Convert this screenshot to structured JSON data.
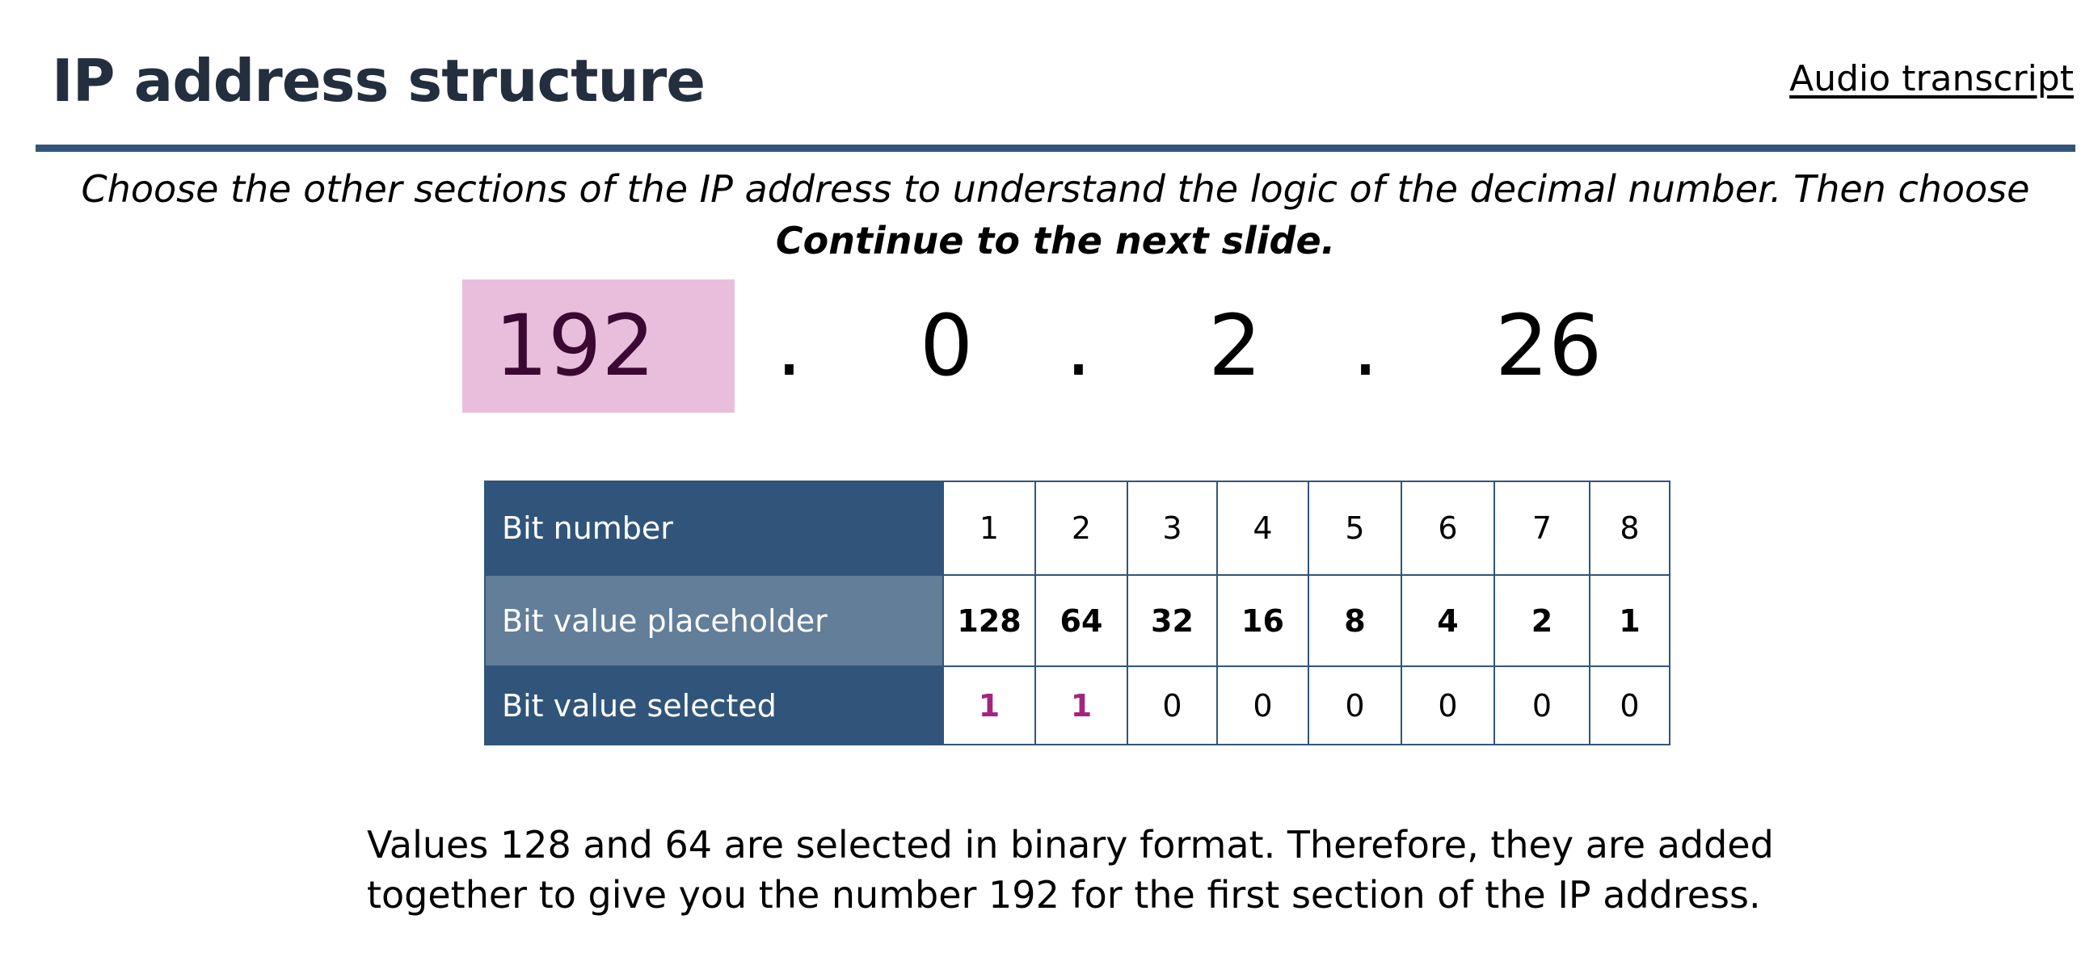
{
  "header": {
    "title": "IP address structure",
    "transcript_link": "Audio transcript"
  },
  "instructions": {
    "line1": "Choose the other sections of the IP address to understand the logic of the decimal number. Then choose",
    "line2": "Continue to the next slide."
  },
  "ip_address": {
    "octets": [
      "192",
      "0",
      "2",
      "26"
    ],
    "separator": ".",
    "selected_index": 0
  },
  "bit_table": {
    "rows": [
      {
        "label": "Bit number",
        "cells": [
          "1",
          "2",
          "3",
          "4",
          "5",
          "6",
          "7",
          "8"
        ]
      },
      {
        "label": "Bit value placeholder",
        "cells": [
          "128",
          "64",
          "32",
          "16",
          "8",
          "4",
          "2",
          "1"
        ]
      },
      {
        "label": "Bit value selected",
        "cells": [
          "1",
          "1",
          "0",
          "0",
          "0",
          "0",
          "0",
          "0"
        ]
      }
    ]
  },
  "explanation": {
    "line1": "Values 128 and 64 are selected in binary format. Therefore, they are added",
    "line2": "together to give you the number 192 for the first section of the IP address."
  },
  "colors": {
    "title": "#232f3e",
    "rule": "#31557a",
    "selected_octet_bg": "#e8bedc",
    "selected_bit": "#a3257e",
    "table_header_dark": "#31557a",
    "table_header_light": "#627e99"
  }
}
